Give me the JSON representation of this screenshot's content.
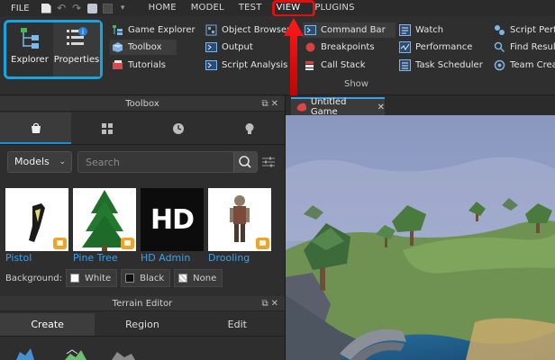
{
  "menubar": {
    "file": "FILE",
    "tabs": [
      "HOME",
      "MODEL",
      "TEST",
      "VIEW",
      "PLUGINS"
    ]
  },
  "ribbon": {
    "explorer": "Explorer",
    "properties": "Properties",
    "items": {
      "game_explorer": "Game Explorer",
      "toolbox": "Toolbox",
      "tutorials": "Tutorials",
      "object_browser": "Object Browser",
      "output": "Output",
      "script_analysis": "Script Analysis",
      "command_bar": "Command Bar",
      "breakpoints": "Breakpoints",
      "call_stack": "Call Stack",
      "watch": "Watch",
      "performance": "Performance",
      "task_scheduler": "Task Scheduler",
      "script_perf": "Script Perfo",
      "find_results": "Find Result",
      "team_create": "Team Creat"
    },
    "section_label": "Show"
  },
  "toolbox": {
    "title": "Toolbox",
    "category": "Models",
    "search_placeholder": "Search",
    "models": [
      {
        "name": "Pistol"
      },
      {
        "name": "Pine Tree"
      },
      {
        "name": "HD Admin",
        "thumb_text": "HD"
      },
      {
        "name": "Drooling"
      }
    ],
    "background_label": "Background:",
    "backgrounds": [
      "White",
      "Black",
      "None"
    ]
  },
  "terrain": {
    "title": "Terrain Editor",
    "tabs": [
      "Create",
      "Region",
      "Edit"
    ]
  },
  "document": {
    "tab_title": "Untitled Game"
  },
  "colors": {
    "accent_blue": "#16a5e0",
    "highlight_red": "#e01010",
    "link_blue": "#3aa2ef",
    "badge_orange": "#f0a32a"
  }
}
